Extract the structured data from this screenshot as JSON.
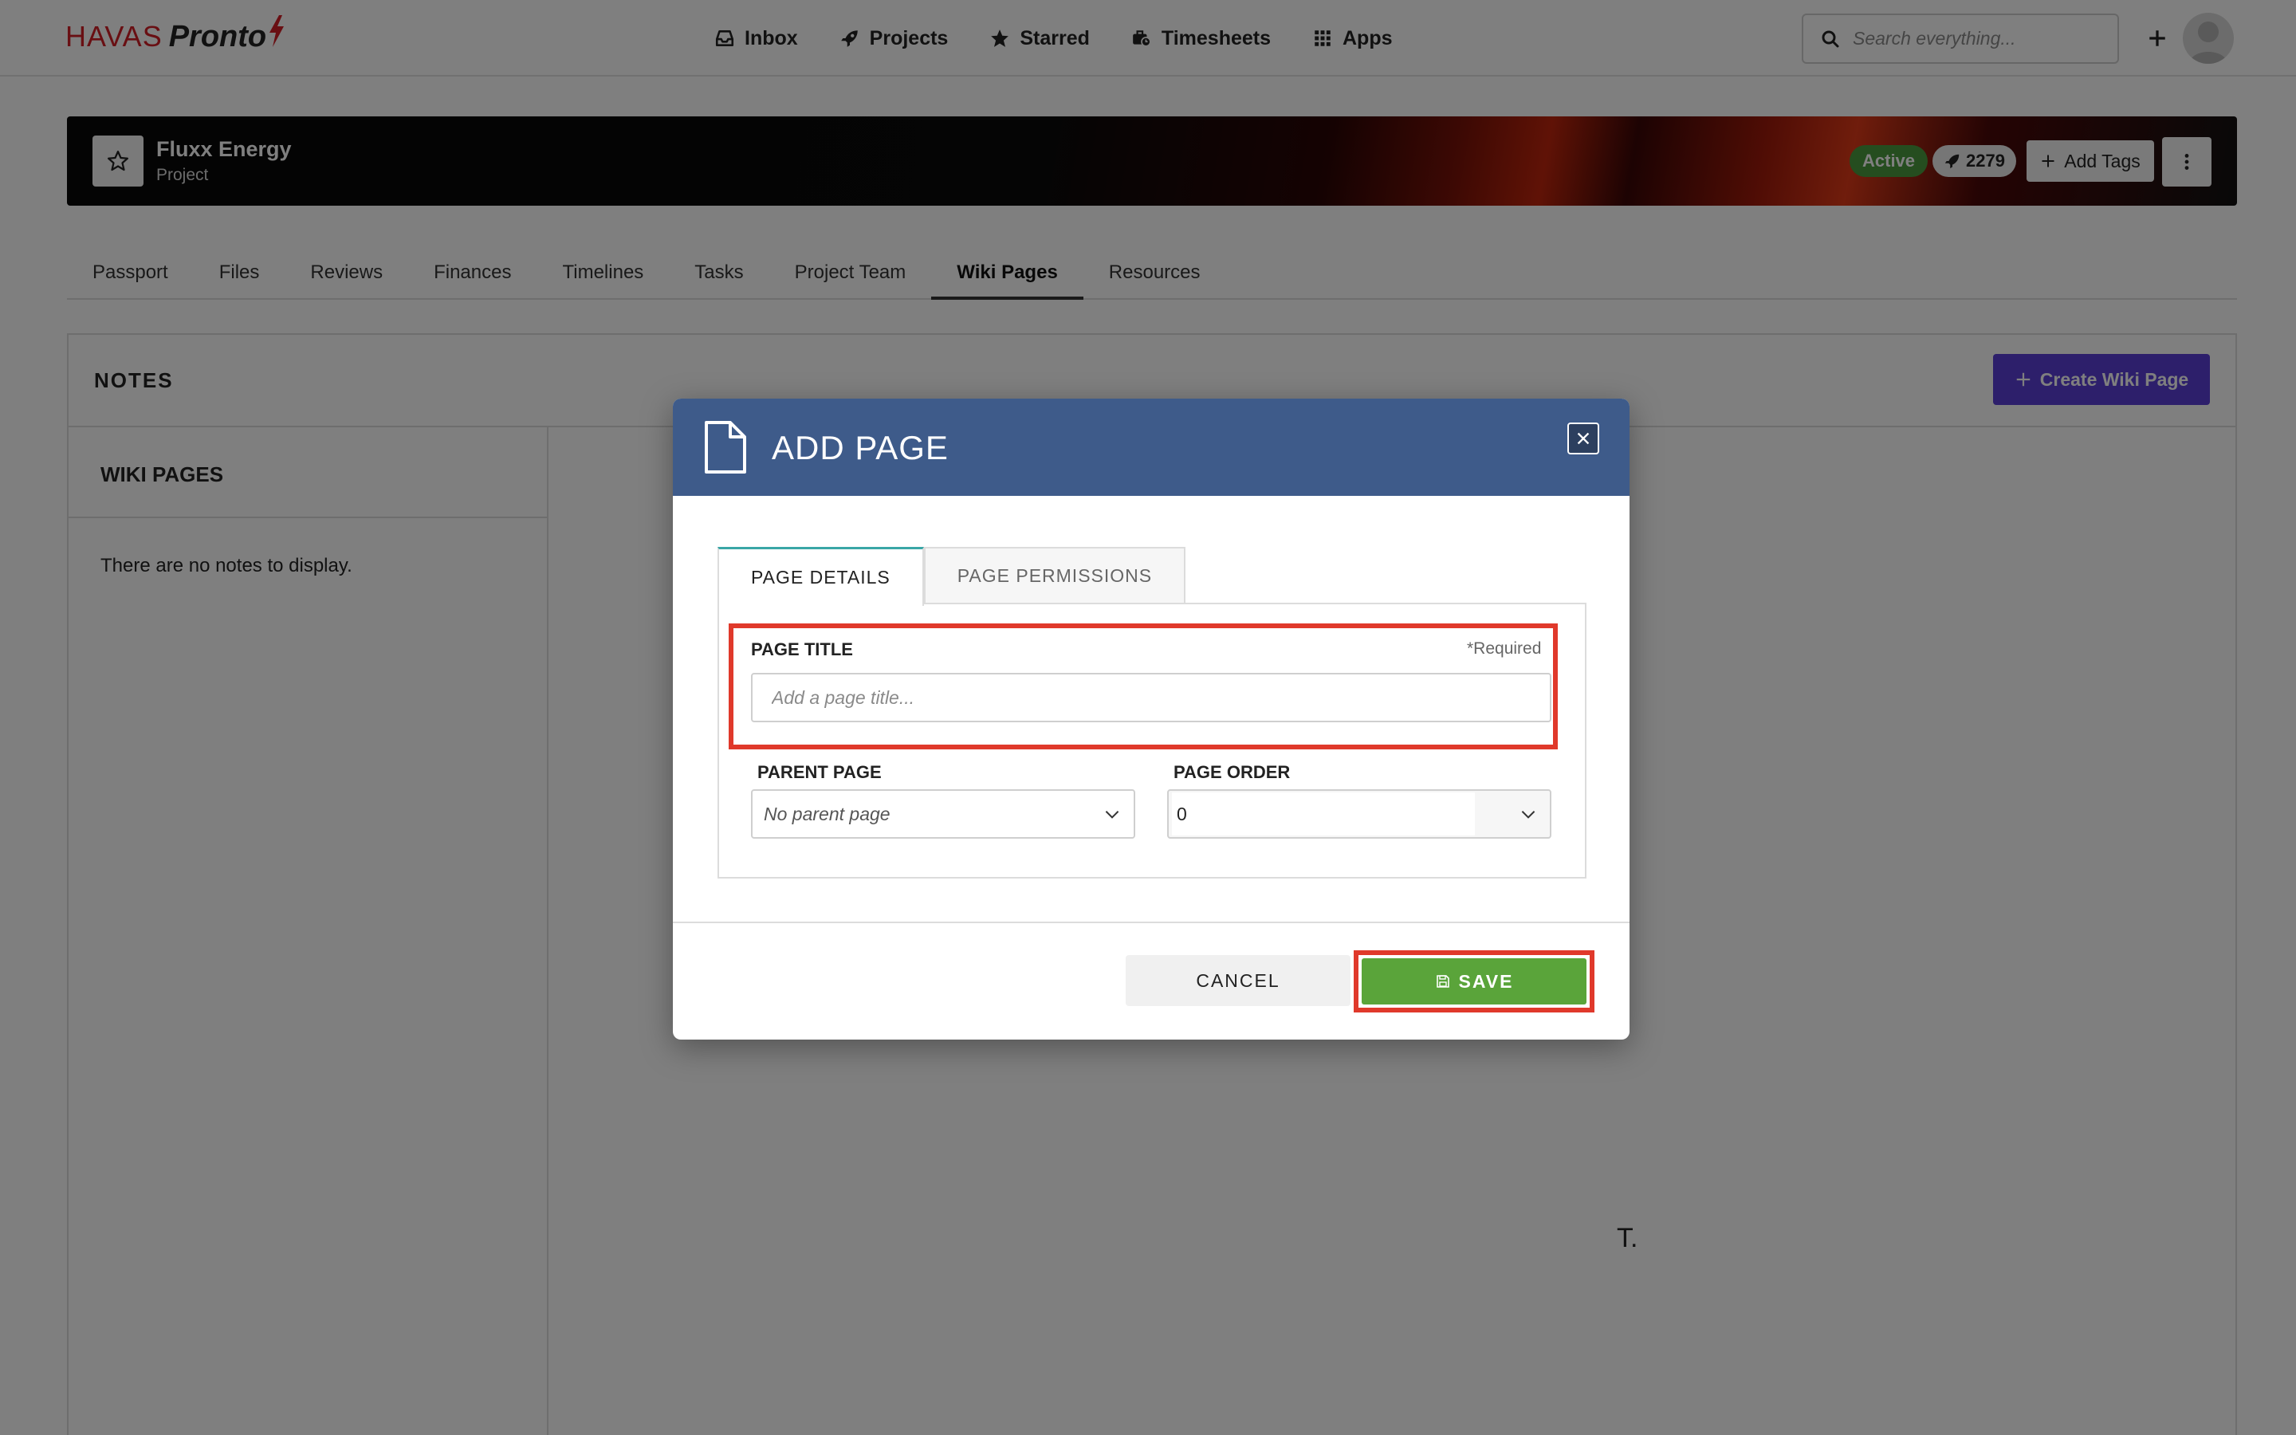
{
  "app": {
    "logo_brand": "HAVAS",
    "logo_product": "Pronto",
    "nav": [
      {
        "label": "Inbox",
        "icon": "inbox-icon"
      },
      {
        "label": "Projects",
        "icon": "rocket-icon"
      },
      {
        "label": "Starred",
        "icon": "star-icon"
      },
      {
        "label": "Timesheets",
        "icon": "briefcase-clock-icon"
      },
      {
        "label": "Apps",
        "icon": "grid-icon"
      }
    ],
    "search_placeholder": "Search everything..."
  },
  "project": {
    "title": "Fluxx Energy",
    "subtitle": "Project",
    "status": "Active",
    "count": "2279",
    "add_tags_label": "Add Tags",
    "status_color": "#4a9a3e"
  },
  "tabs": [
    {
      "label": "Passport",
      "active": false
    },
    {
      "label": "Files",
      "active": false
    },
    {
      "label": "Reviews",
      "active": false
    },
    {
      "label": "Finances",
      "active": false
    },
    {
      "label": "Timelines",
      "active": false
    },
    {
      "label": "Tasks",
      "active": false
    },
    {
      "label": "Project Team",
      "active": false
    },
    {
      "label": "Wiki Pages",
      "active": true
    },
    {
      "label": "Resources",
      "active": false
    }
  ],
  "notes": {
    "title": "NOTES",
    "create_button": "Create Wiki Page",
    "sidebar_title": "WIKI PAGES",
    "empty_text": "There are no notes to display.",
    "peek_text": "T."
  },
  "modal": {
    "title": "ADD PAGE",
    "header_color": "#3e5b8a",
    "tabs": [
      {
        "label": "PAGE DETAILS",
        "active": true
      },
      {
        "label": "PAGE PERMISSIONS",
        "active": false
      }
    ],
    "page_title_label": "PAGE TITLE",
    "required_note": "*Required",
    "page_title_placeholder": "Add a page title...",
    "parent_page_label": "PARENT PAGE",
    "parent_page_value": "No parent page",
    "page_order_label": "PAGE ORDER",
    "page_order_value": "0",
    "cancel_label": "CANCEL",
    "save_label": "SAVE",
    "highlight_color": "#e0392b",
    "save_color": "#5aa43a"
  }
}
